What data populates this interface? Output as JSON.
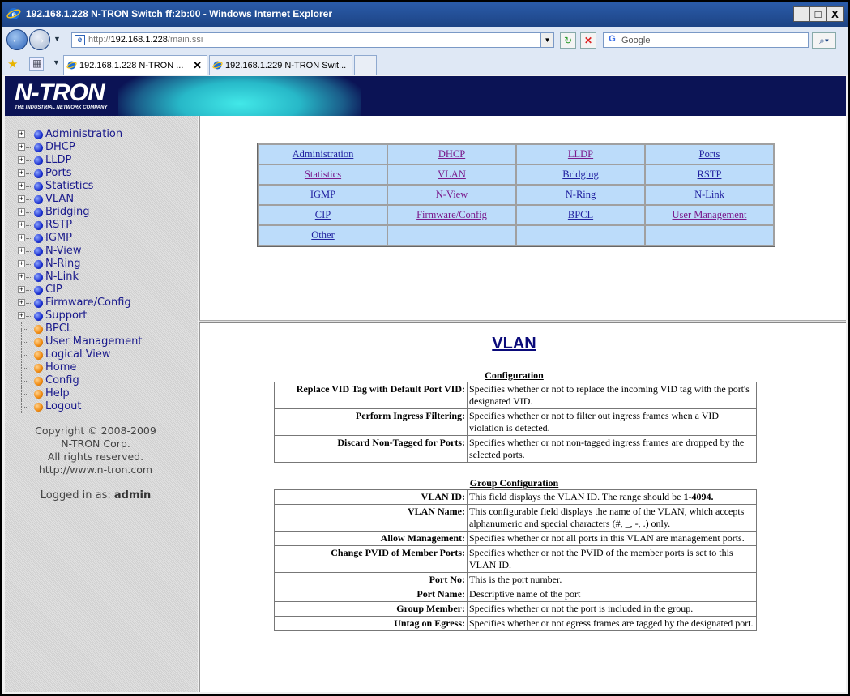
{
  "window": {
    "title": "192.168.1.228 N-TRON Switch ff:2b:00 - Windows Internet Explorer",
    "minimize": "_",
    "maximize": "□",
    "close": "X"
  },
  "address": {
    "url_prefix": "http://",
    "url_host": "192.168.1.228",
    "url_path": "/main.ssi",
    "search_placeholder": "Google"
  },
  "tabs": [
    {
      "label": "192.168.1.228 N-TRON ...",
      "active": true
    },
    {
      "label": "192.168.1.229 N-TRON Swit...",
      "active": false
    }
  ],
  "banner": {
    "logo": "N-TRON",
    "tagline": "THE INDUSTRIAL NETWORK COMPANY"
  },
  "sidebar": {
    "items": [
      {
        "label": "Administration",
        "expandable": true
      },
      {
        "label": "DHCP",
        "expandable": true
      },
      {
        "label": "LLDP",
        "expandable": true
      },
      {
        "label": "Ports",
        "expandable": true
      },
      {
        "label": "Statistics",
        "expandable": true
      },
      {
        "label": "VLAN",
        "expandable": true
      },
      {
        "label": "Bridging",
        "expandable": true
      },
      {
        "label": "RSTP",
        "expandable": true
      },
      {
        "label": "IGMP",
        "expandable": true
      },
      {
        "label": "N-View",
        "expandable": true
      },
      {
        "label": "N-Ring",
        "expandable": true
      },
      {
        "label": "N-Link",
        "expandable": true
      },
      {
        "label": "CIP",
        "expandable": true
      },
      {
        "label": "Firmware/Config",
        "expandable": true
      },
      {
        "label": "Support",
        "expandable": true
      },
      {
        "label": "BPCL",
        "expandable": false
      },
      {
        "label": "User Management",
        "expandable": false
      },
      {
        "label": "Logical View",
        "expandable": false
      },
      {
        "label": "Home",
        "expandable": false
      },
      {
        "label": "Config",
        "expandable": false
      },
      {
        "label": "Help",
        "expandable": false
      },
      {
        "label": "Logout",
        "expandable": false
      }
    ],
    "copyright": [
      "Copyright © 2008-2009",
      "N-TRON Corp.",
      "All rights reserved.",
      "http://www.n-tron.com"
    ],
    "logged_in_label": "Logged in as:",
    "logged_in_user": "admin"
  },
  "navgrid": {
    "rows": [
      [
        "Administration",
        "DHCP",
        "LLDP",
        "Ports"
      ],
      [
        "Statistics",
        "VLAN",
        "Bridging",
        "RSTP"
      ],
      [
        "IGMP",
        "N-View",
        "N-Ring",
        "N-Link"
      ],
      [
        "CIP",
        "Firmware/Config",
        "BPCL",
        "User Management"
      ],
      [
        "Other",
        "",
        "",
        ""
      ]
    ]
  },
  "help": {
    "title": "VLAN",
    "config_heading": "Configuration",
    "config_rows": [
      {
        "key": "Replace VID Tag with Default Port VID:",
        "desc": "Specifies whether or not to replace the incoming VID tag with the port's designated VID."
      },
      {
        "key": "Perform Ingress Filtering:",
        "desc": "Specifies whether or not to filter out ingress frames when a VID violation is detected."
      },
      {
        "key": "Discard Non-Tagged for Ports:",
        "desc": "Specifies whether or not non-tagged ingress frames are dropped by the selected ports."
      }
    ],
    "group_heading": "Group Configuration",
    "group_rows": [
      {
        "key": "VLAN ID:",
        "desc": "This field displays the VLAN ID. The range should be ",
        "desc_bold": "1-4094",
        "desc_end": "."
      },
      {
        "key": "VLAN Name:",
        "desc": "This configurable field displays the name of the VLAN, which accepts alphanumeric and special characters (#, _, -, .) only."
      },
      {
        "key": "Allow Management:",
        "desc": "Specifies whether or not all ports in this VLAN are management ports."
      },
      {
        "key": "Change PVID of Member Ports:",
        "desc": "Specifies whether or not the PVID of the member ports is set to this VLAN ID."
      },
      {
        "key": "Port No:",
        "desc": "This is the port number."
      },
      {
        "key": "Port Name:",
        "desc": "Descriptive name of the port"
      },
      {
        "key": "Group Member:",
        "desc": "Specifies whether or not the port is included in the group."
      },
      {
        "key": "Untag on Egress:",
        "desc": "Specifies whether or not egress frames are tagged by the designated port."
      }
    ]
  }
}
